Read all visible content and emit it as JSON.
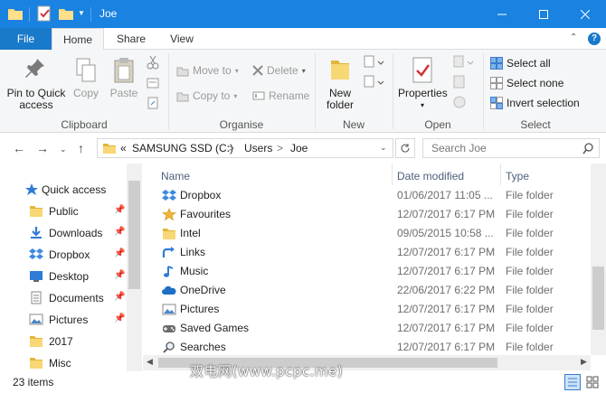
{
  "window": {
    "title": "Joe"
  },
  "ribbon_tabs": [
    "File",
    "Home",
    "Share",
    "View"
  ],
  "ribbon": {
    "clipboard": {
      "pin_label_1": "Pin to Quick",
      "pin_label_2": "access",
      "copy": "Copy",
      "paste": "Paste",
      "group": "Clipboard"
    },
    "organise": {
      "move_to": "Move to",
      "copy_to": "Copy to",
      "delete": "Delete",
      "rename": "Rename",
      "group": "Organise"
    },
    "new": {
      "new_folder_1": "New",
      "new_folder_2": "folder",
      "group": "New"
    },
    "open": {
      "properties": "Properties",
      "group": "Open"
    },
    "select": {
      "select_all": "Select all",
      "select_none": "Select none",
      "invert_selection": "Invert selection",
      "group": "Select"
    }
  },
  "address": {
    "overflow": "«",
    "crumbs": [
      "SAMSUNG SSD (C:)",
      "Users",
      "Joe"
    ],
    "separator": ">",
    "search_placeholder": "Search Joe"
  },
  "nav_pane": {
    "quick_access": "Quick access",
    "items": [
      {
        "label": "Public",
        "icon": "folder-icon",
        "pinned": true
      },
      {
        "label": "Downloads",
        "icon": "downloads-icon",
        "pinned": true
      },
      {
        "label": "Dropbox",
        "icon": "dropbox-icon",
        "pinned": true
      },
      {
        "label": "Desktop",
        "icon": "desktop-icon",
        "pinned": true
      },
      {
        "label": "Documents",
        "icon": "documents-icon",
        "pinned": true
      },
      {
        "label": "Pictures",
        "icon": "pictures-icon",
        "pinned": true
      },
      {
        "label": "2017",
        "icon": "folder-icon",
        "pinned": false
      },
      {
        "label": "Misc",
        "icon": "folder-icon",
        "pinned": false
      }
    ]
  },
  "columns": {
    "name": "Name",
    "date": "Date modified",
    "type": "Type"
  },
  "files": [
    {
      "name": "Dropbox",
      "date": "01/06/2017 11:05 ...",
      "type": "File folder",
      "icon": "dropbox-icon"
    },
    {
      "name": "Favourites",
      "date": "12/07/2017 6:17 PM",
      "type": "File folder",
      "icon": "star-icon"
    },
    {
      "name": "Intel",
      "date": "09/05/2015 10:58 ...",
      "type": "File folder",
      "icon": "folder-icon"
    },
    {
      "name": "Links",
      "date": "12/07/2017 6:17 PM",
      "type": "File folder",
      "icon": "links-icon"
    },
    {
      "name": "Music",
      "date": "12/07/2017 6:17 PM",
      "type": "File folder",
      "icon": "music-icon"
    },
    {
      "name": "OneDrive",
      "date": "22/06/2017 6:22 PM",
      "type": "File folder",
      "icon": "onedrive-icon"
    },
    {
      "name": "Pictures",
      "date": "12/07/2017 6:17 PM",
      "type": "File folder",
      "icon": "pictures-icon"
    },
    {
      "name": "Saved Games",
      "date": "12/07/2017 6:17 PM",
      "type": "File folder",
      "icon": "saved-games-icon"
    },
    {
      "name": "Searches",
      "date": "12/07/2017 6:17 PM",
      "type": "File folder",
      "icon": "searches-icon"
    }
  ],
  "status": {
    "item_count": "23 items"
  },
  "watermark": "双电网(www.pcpc.me)",
  "colors": {
    "titlebar": "#1a82e0",
    "file_tab": "#1979ca",
    "folder": "#f8d775"
  }
}
